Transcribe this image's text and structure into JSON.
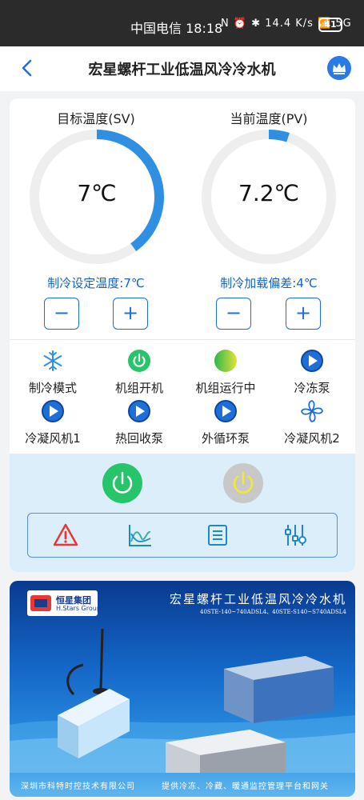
{
  "status_bar": {
    "carrier_time": "中国电信 18:18",
    "indicators": "N ⏰ ✱ 14.4 K/s 📶 5G",
    "battery": "41"
  },
  "header": {
    "title": "宏星螺杆工业低温风冷冷水机"
  },
  "gauges": {
    "target": {
      "label": "目标温度(SV)",
      "value": "7℃",
      "fill": 0.4,
      "setting_label": "制冷设定温度:7℃"
    },
    "current": {
      "label": "当前温度(PV)",
      "value": "7.2℃",
      "fill": 0.05,
      "setting_label": "制冷加载偏差:4℃"
    },
    "decrease_symbol": "−",
    "increase_symbol": "+"
  },
  "status_items": [
    {
      "label": "制冷模式",
      "icon": "snowflake-icon"
    },
    {
      "label": "机组开机",
      "icon": "power-on-icon"
    },
    {
      "label": "机组运行中",
      "icon": "running-indicator-icon"
    },
    {
      "label": "冷冻泵",
      "icon": "play-icon"
    },
    {
      "label": "冷凝风机1",
      "icon": "play-icon"
    },
    {
      "label": "热回收泵",
      "icon": "play-icon"
    },
    {
      "label": "外循环泵",
      "icon": "play-icon"
    },
    {
      "label": "冷凝风机2",
      "icon": "fan-icon"
    }
  ],
  "controls": {
    "power_on_color": "#27c46a",
    "power_off_color": "#c8c8c8",
    "tools": [
      "alarm-icon",
      "trend-chart-icon",
      "list-icon",
      "settings-sliders-icon"
    ]
  },
  "banner": {
    "logo_text": "恒星集团",
    "logo_sub": "H.Stars Group",
    "title": "宏星螺杆工业低温风冷冷水机",
    "models": "40STE-140~740ADSL4、40STE-S140~S740ADSL4",
    "footer_left": "深圳市科特时控技术有限公司",
    "footer_right": "提供冷冻、冷藏、暖通监控管理平台和网关"
  },
  "colors": {
    "accent": "#1e6fd9",
    "gauge_arc": "#2f8fe3",
    "gauge_track": "#eeeeee"
  }
}
